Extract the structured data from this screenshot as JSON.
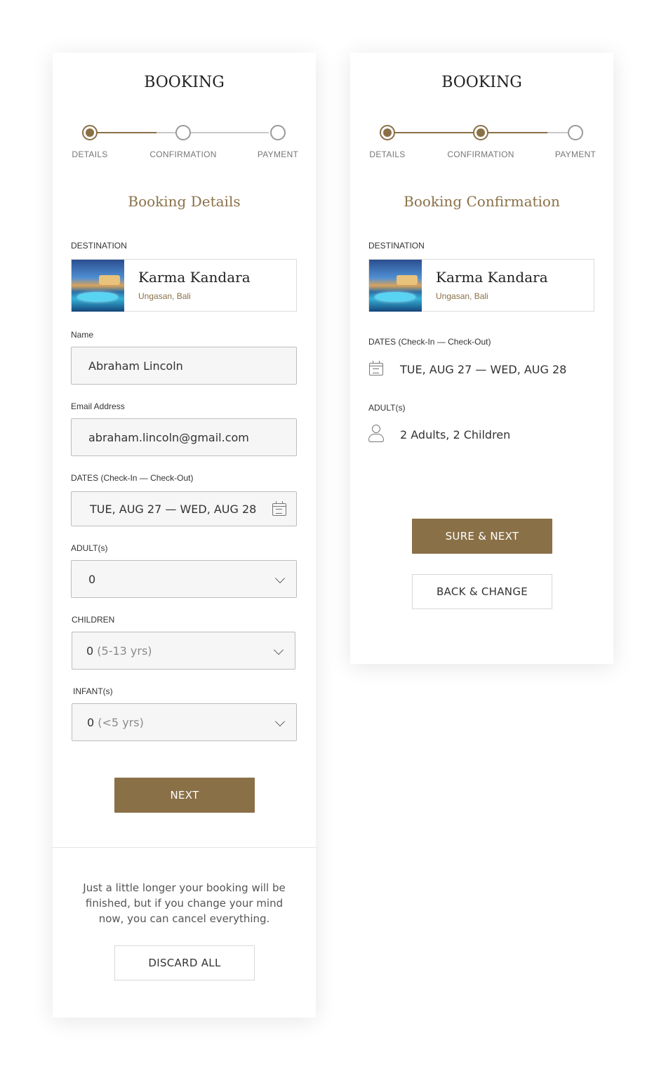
{
  "colors": {
    "accent": "#8a7047",
    "muted_step": "#c8c8c8"
  },
  "left": {
    "title": "BOOKING",
    "steps": [
      "DETAILS",
      "CONFIRMATION",
      "PAYMENT"
    ],
    "section_title": "Booking Details",
    "destination": {
      "label": "DESTINATION",
      "name": "Karma Kandara",
      "location": "Ungasan, Bali"
    },
    "name": {
      "label": "Name",
      "value": "Abraham Lincoln"
    },
    "email": {
      "label": "Email Address",
      "value": "abraham.lincoln@gmail.com"
    },
    "dates": {
      "label": "DATES (Check-In — Check-Out)",
      "value": "TUE, AUG 27 — WED, AUG 28",
      "icon": "calendar-icon"
    },
    "adults": {
      "label": "ADULT(s)",
      "value": "0"
    },
    "children": {
      "label": "CHILDREN",
      "value": "0",
      "hint": "(5-13 yrs)"
    },
    "infants": {
      "label": "INFANT(s)",
      "value": "0",
      "hint": "(<5 yrs)"
    },
    "next_button": "NEXT",
    "note": "Just a little longer your booking will be finished, but if you change your mind now, you can cancel everything.",
    "discard_button": "DISCARD  ALL"
  },
  "right": {
    "title": "BOOKING",
    "steps": [
      "DETAILS",
      "CONFIRMATION",
      "PAYMENT"
    ],
    "section_title": "Booking Confirmation",
    "destination": {
      "label": "DESTINATION",
      "name": "Karma Kandara",
      "location": "Ungasan, Bali"
    },
    "dates": {
      "label": "DATES (Check-In — Check-Out)",
      "value": "TUE, AUG 27 — WED, AUG 28",
      "icon": "calendar-icon"
    },
    "adults": {
      "label": "ADULT(s)",
      "value": "2 Adults, 2 Children",
      "icon": "user-icon"
    },
    "sure_button": "SURE & NEXT",
    "back_button": "BACK & CHANGE"
  }
}
